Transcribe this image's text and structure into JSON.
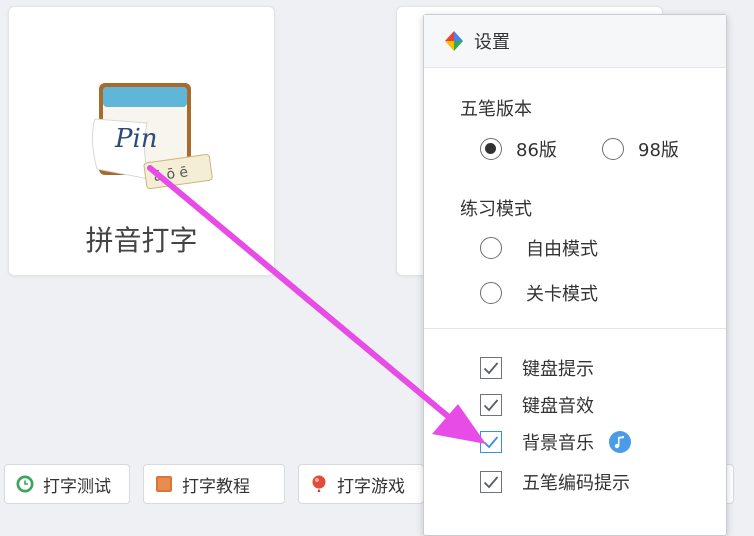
{
  "cards": {
    "pinyin": {
      "title": "拼音打字",
      "icon_text": "Pin",
      "tone_marks": "ā ō ē"
    }
  },
  "bottom_bar": {
    "test_label": "打字测试",
    "tutorial_label": "打字教程",
    "game_label": "打字游戏"
  },
  "dialog": {
    "title": "设置",
    "version_section": "五笔版本",
    "version_86": "86版",
    "version_98": "98版",
    "version_selected": "86版",
    "mode_section": "练习模式",
    "mode_free": "自由模式",
    "mode_level": "关卡模式",
    "checks": [
      {
        "label": "键盘提示",
        "checked": true
      },
      {
        "label": "键盘音效",
        "checked": true
      },
      {
        "label": "背景音乐",
        "checked": true
      },
      {
        "label": "五笔编码提示",
        "checked": true
      }
    ]
  },
  "colors": {
    "annotation_arrow": "#e84ce6",
    "check_highlight": "#3a8ee6",
    "music_icon": "#4a9be8"
  }
}
